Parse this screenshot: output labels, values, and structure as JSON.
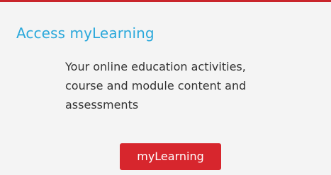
{
  "card": {
    "title": "Access myLearning",
    "description": "Your online education activities, course and module content and assessments",
    "button_label": "myLearning"
  },
  "colors": {
    "accent_border": "#c9252b",
    "title": "#2aa8db",
    "button_background": "#d7262d",
    "card_background": "#f4f4f4"
  }
}
